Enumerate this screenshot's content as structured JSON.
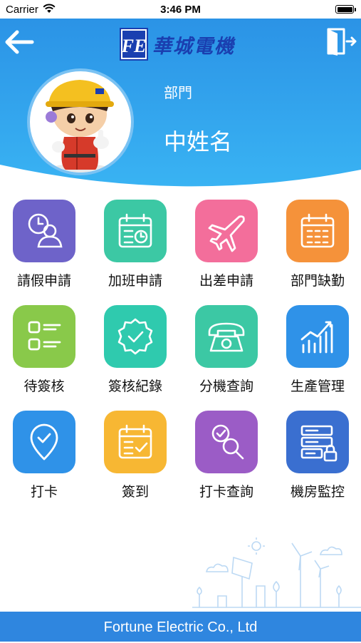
{
  "status_bar": {
    "carrier": "Carrier",
    "time": "3:46 PM"
  },
  "header": {
    "logo_mark": "FE",
    "logo_text": "華城電機",
    "department": "部門",
    "user_name": "中姓名",
    "colors": {
      "gradient_top": "#2b93e6",
      "gradient_bottom": "#39b3f3"
    }
  },
  "menu": {
    "items": [
      {
        "label": "請假申請",
        "icon": "clock-user-icon",
        "color": "#6e63c9"
      },
      {
        "label": "加班申請",
        "icon": "calendar-clock-icon",
        "color": "#3cc8a4"
      },
      {
        "label": "出差申請",
        "icon": "airplane-icon",
        "color": "#f36e9b"
      },
      {
        "label": "部門缺勤",
        "icon": "calendar-grid-icon",
        "color": "#f5923a"
      },
      {
        "label": "待簽核",
        "icon": "checklist-icon",
        "color": "#89c94a"
      },
      {
        "label": "簽核紀錄",
        "icon": "badge-check-icon",
        "color": "#2fcaae"
      },
      {
        "label": "分機查詢",
        "icon": "telephone-icon",
        "color": "#3cc8a4"
      },
      {
        "label": "生產管理",
        "icon": "bar-chart-icon",
        "color": "#2f92e8"
      },
      {
        "label": "打卡",
        "icon": "location-check-icon",
        "color": "#2f92e8"
      },
      {
        "label": "簽到",
        "icon": "calendar-check-icon",
        "color": "#f7b733"
      },
      {
        "label": "打卡查詢",
        "icon": "search-check-icon",
        "color": "#9b5cc6"
      },
      {
        "label": "機房監控",
        "icon": "server-lock-icon",
        "color": "#3a6fd0"
      }
    ]
  },
  "footer": {
    "text": "Fortune Electric Co., Ltd",
    "color": "#2f86df"
  }
}
